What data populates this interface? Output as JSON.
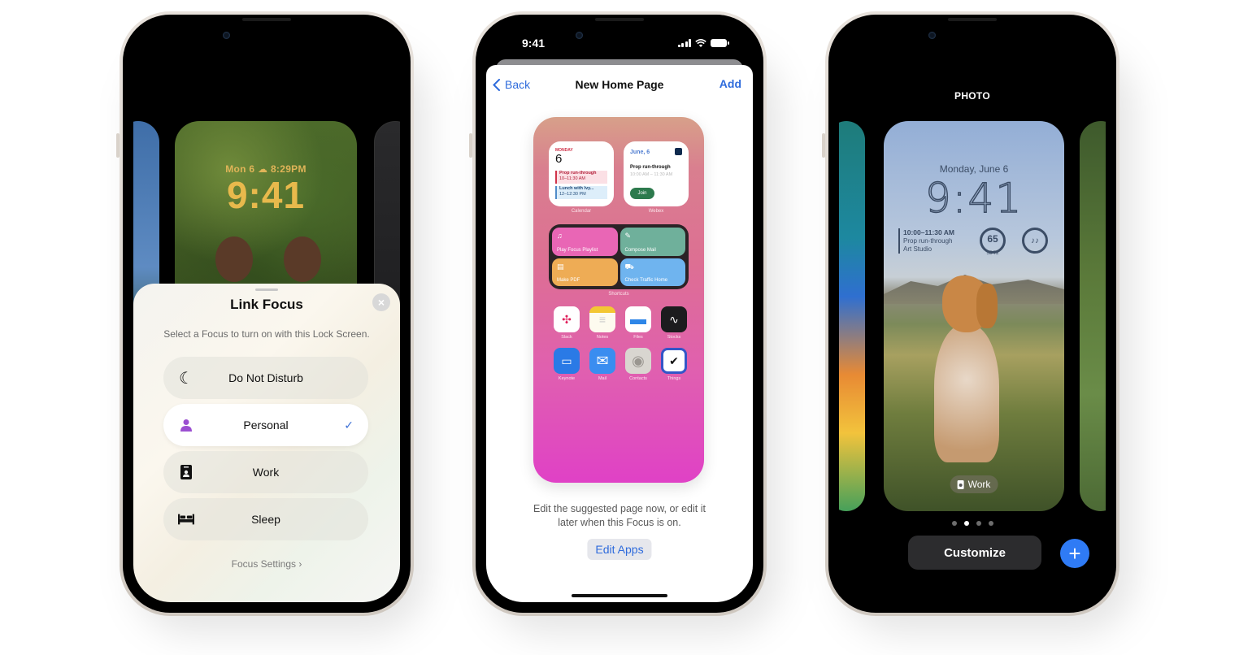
{
  "phone1": {
    "lock_preview": {
      "date_weather": "Mon 6  ☁ 8:29PM",
      "time": "9:41"
    },
    "sheet": {
      "title": "Link Focus",
      "subtitle": "Select a Focus to turn on with this Lock Screen.",
      "close_icon": "×",
      "items": [
        {
          "label": "Do Not Disturb",
          "icon": "moon-icon",
          "glyph": "☾",
          "selected": false
        },
        {
          "label": "Personal",
          "icon": "person-icon",
          "glyph": "●",
          "selected": true,
          "check": "✓"
        },
        {
          "label": "Work",
          "icon": "id-badge-icon",
          "glyph": "▮",
          "selected": false
        },
        {
          "label": "Sleep",
          "icon": "bed-icon",
          "glyph": "▬",
          "selected": false
        }
      ],
      "footer_link": "Focus Settings ›"
    }
  },
  "phone2": {
    "status_bar": {
      "time": "9:41"
    },
    "nav": {
      "back": "Back",
      "title": "New Home Page",
      "add": "Add"
    },
    "preview": {
      "calendar_widget": {
        "day": "MONDAY",
        "date": "6",
        "events": [
          {
            "title": "Prop run-through",
            "time": "10–11:30 AM"
          },
          {
            "title": "Lunch with Ivy...",
            "time": "12–12:30 PM"
          }
        ],
        "label": "Calendar"
      },
      "webex_widget": {
        "date": "June, 6",
        "title": "Prop run-through",
        "time": "10:00 AM – 11:30 AM",
        "join": "Join",
        "label": "Webex"
      },
      "shortcuts": {
        "items": [
          {
            "label": "Play Focus Playlist",
            "glyph": "♫",
            "color": "#e966b5"
          },
          {
            "label": "Compose Mail",
            "glyph": "✎",
            "color": "#6fb09b"
          },
          {
            "label": "Make PDF",
            "glyph": "▤",
            "color": "#eeac55"
          },
          {
            "label": "Check Traffic Home",
            "glyph": "⛟",
            "color": "#6fb4ef"
          }
        ],
        "label": "Shortcuts"
      },
      "apps": [
        {
          "label": "Slack",
          "glyph": "✣",
          "bg": "#ffffff",
          "fg": "#e01e5a"
        },
        {
          "label": "Notes",
          "glyph": "≡",
          "bg": "#fdfbef",
          "fg": "#f3c733"
        },
        {
          "label": "Files",
          "glyph": "▬",
          "bg": "#ffffff",
          "fg": "#2e86e8"
        },
        {
          "label": "Stocks",
          "glyph": "∿",
          "bg": "#1c1c1e",
          "fg": "#ffffff"
        },
        {
          "label": "Keynote",
          "glyph": "▭",
          "bg": "#2a7ae6",
          "fg": "#ffffff"
        },
        {
          "label": "Mail",
          "glyph": "✉",
          "bg": "#3a8df0",
          "fg": "#ffffff"
        },
        {
          "label": "Contacts",
          "glyph": "◉",
          "bg": "#d9d6d0",
          "fg": "#9a9690"
        },
        {
          "label": "Things",
          "glyph": "✔",
          "bg": "#3356c8",
          "fg": "#111111"
        }
      ]
    },
    "caption": "Edit the suggested page now, or edit it later when this Focus is on.",
    "edit_apps": "Edit Apps"
  },
  "phone3": {
    "style_label": "PHOTO",
    "lock_preview": {
      "date": "Monday, June 6",
      "time": "9:41",
      "event": {
        "time": "10:00–11:30 AM",
        "title": "Prop run-through",
        "location": "Art Studio"
      },
      "weather_gauge": {
        "value": "65",
        "range": "55  72"
      },
      "airpods_gauge": "airpods-icon"
    },
    "focus_chip": "Work",
    "page_dots": {
      "count": 4,
      "active_index": 1
    },
    "customize": "Customize",
    "add_icon": "+"
  }
}
